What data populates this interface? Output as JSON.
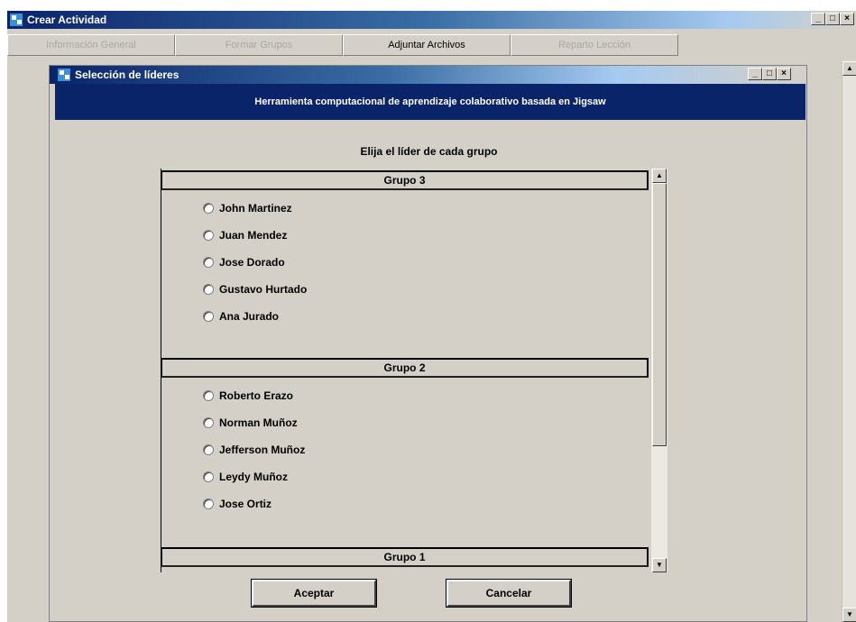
{
  "outer_window": {
    "title": "Crear Actividad",
    "controls": [
      "_",
      "□",
      "×"
    ]
  },
  "tabs": [
    {
      "label": "Información General",
      "enabled": false
    },
    {
      "label": "Formar Grupos",
      "enabled": false
    },
    {
      "label": "Adjuntar Archivos",
      "enabled": true
    },
    {
      "label": "Reparto Lección",
      "enabled": false
    }
  ],
  "dialog": {
    "title": "Selección de líderes",
    "controls": [
      "_",
      "□",
      "×"
    ],
    "banner": "Herramienta computacional de aprendizaje colaborativo basada en Jigsaw",
    "instruction": "Elija el líder de cada grupo"
  },
  "groups": [
    {
      "name": "Grupo 3",
      "members": [
        "John Martinez",
        "Juan Mendez",
        "Jose Dorado",
        "Gustavo Hurtado",
        "Ana Jurado"
      ]
    },
    {
      "name": "Grupo 2",
      "members": [
        "Roberto Erazo",
        "Norman Muñoz",
        "Jefferson Muñoz",
        "Leydy Muñoz",
        "Jose Ortiz"
      ]
    },
    {
      "name": "Grupo 1",
      "members": []
    }
  ],
  "buttons": {
    "accept": "Aceptar",
    "cancel": "Cancelar"
  },
  "icons": {
    "up": "▲",
    "down": "▼"
  }
}
